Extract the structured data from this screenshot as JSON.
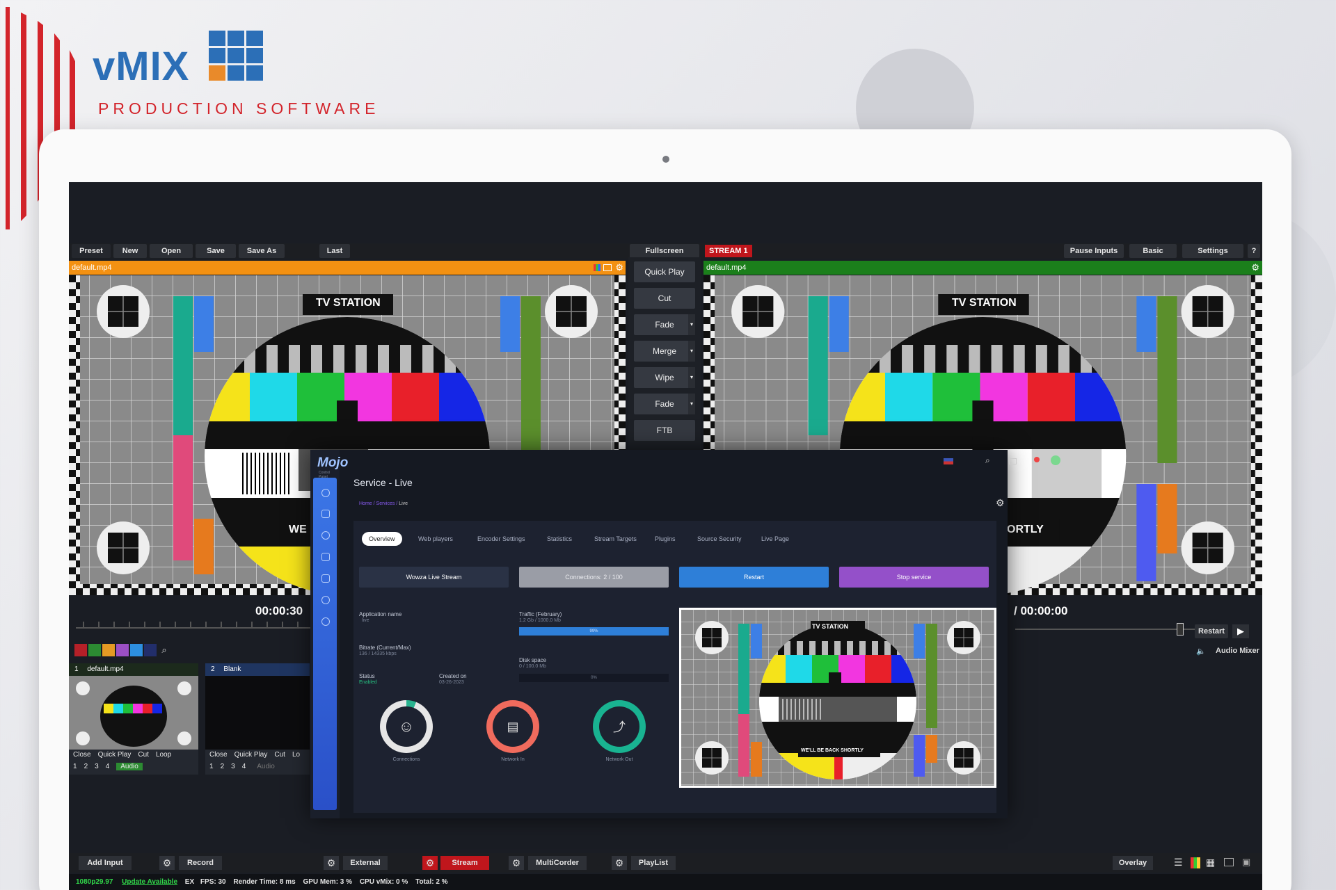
{
  "brand": {
    "title": "vMIX",
    "subtitle": "PRODUCTION   SOFTWARE"
  },
  "toolbar": {
    "preset": "Preset",
    "new": "New",
    "open": "Open",
    "save": "Save",
    "save_as": "Save As",
    "last": "Last",
    "fullscreen": "Fullscreen",
    "stream_badge": "STREAM 1",
    "pause_inputs": "Pause Inputs",
    "basic": "Basic",
    "settings": "Settings",
    "help": "?"
  },
  "preview": {
    "filename": "default.mp4",
    "timecode": "00:00:30",
    "tv_label": "TV STATION",
    "banner_partial": "WE"
  },
  "output": {
    "filename": "default.mp4",
    "timecode": "/ 00:00:00",
    "tv_label": "TV STATION",
    "banner_partial": "ORTLY",
    "restart": "Restart",
    "audio_mixer": "Audio Mixer"
  },
  "transitions": [
    "Quick Play",
    "Cut",
    "Fade",
    "Merge",
    "Wipe",
    "Fade",
    "FTB"
  ],
  "inputs": [
    {
      "number": "1",
      "name": "default.mp4",
      "buttons": [
        "Close",
        "Quick Play",
        "Cut",
        "Loop"
      ],
      "nums": [
        "1",
        "2",
        "3",
        "4"
      ],
      "audio": "Audio"
    },
    {
      "number": "2",
      "name": "Blank",
      "buttons": [
        "Close",
        "Quick Play",
        "Cut",
        "Lo"
      ],
      "nums": [
        "1",
        "2",
        "3",
        "4"
      ],
      "audio": "Audio"
    }
  ],
  "mojo": {
    "logo": "Mojo",
    "logo_sub": "Control Panel",
    "page_title": "Service - Live",
    "breadcrumb": {
      "home": "Home",
      "services": "Services",
      "current": "Live"
    },
    "tabs": [
      "Overview",
      "Web players",
      "Encoder Settings",
      "Statistics",
      "Stream Targets",
      "Plugins",
      "Source Security",
      "Live Page"
    ],
    "buttons": {
      "wowza": "Wowza Live Stream",
      "connections": "Connections: 2 / 100",
      "restart": "Restart",
      "stop": "Stop service"
    },
    "fields": {
      "app_name_label": "Application name",
      "app_name_value": "live",
      "bitrate_label": "Bitrate (Current/Max)",
      "bitrate_value": "136 / 14335 kbps",
      "status_label": "Status",
      "status_value": "Enabled",
      "created_label": "Created on",
      "created_value": "03-26-2023",
      "traffic_label": "Traffic (February)",
      "traffic_value": "1.2 Gb / 1000.0 Mb",
      "traffic_bar": "99%",
      "disk_label": "Disk space",
      "disk_value": "0 / 100.0 Mb",
      "disk_bar": "0%"
    },
    "rings": [
      "Connections",
      "Network In",
      "Network Out"
    ],
    "preview_tv_label": "TV STATION",
    "preview_banner": "WE'LL BE BACK SHORTLY"
  },
  "bottombar": {
    "add_input": "Add Input",
    "record": "Record",
    "external": "External",
    "stream": "Stream",
    "multicorder": "MultiCorder",
    "playlist": "PlayList",
    "overlay": "Overlay"
  },
  "status": {
    "format": "1080p29.97",
    "update": "Update Available",
    "ex": "EX",
    "fps": "FPS: 30",
    "render": "Render Time: 8 ms",
    "gpu": "GPU Mem: 3 %",
    "cpu": "CPU vMix: 0 %",
    "total": "Total: 2 %"
  },
  "colors": {
    "preview_bar": "#f39112",
    "output_bar": "#1b7f1b",
    "accent_blue": "#2e7fd8",
    "purple": "#9450c9",
    "stream_red": "#c0161c",
    "brand_blue": "#2c6fb7",
    "brand_red": "#d3242b"
  }
}
